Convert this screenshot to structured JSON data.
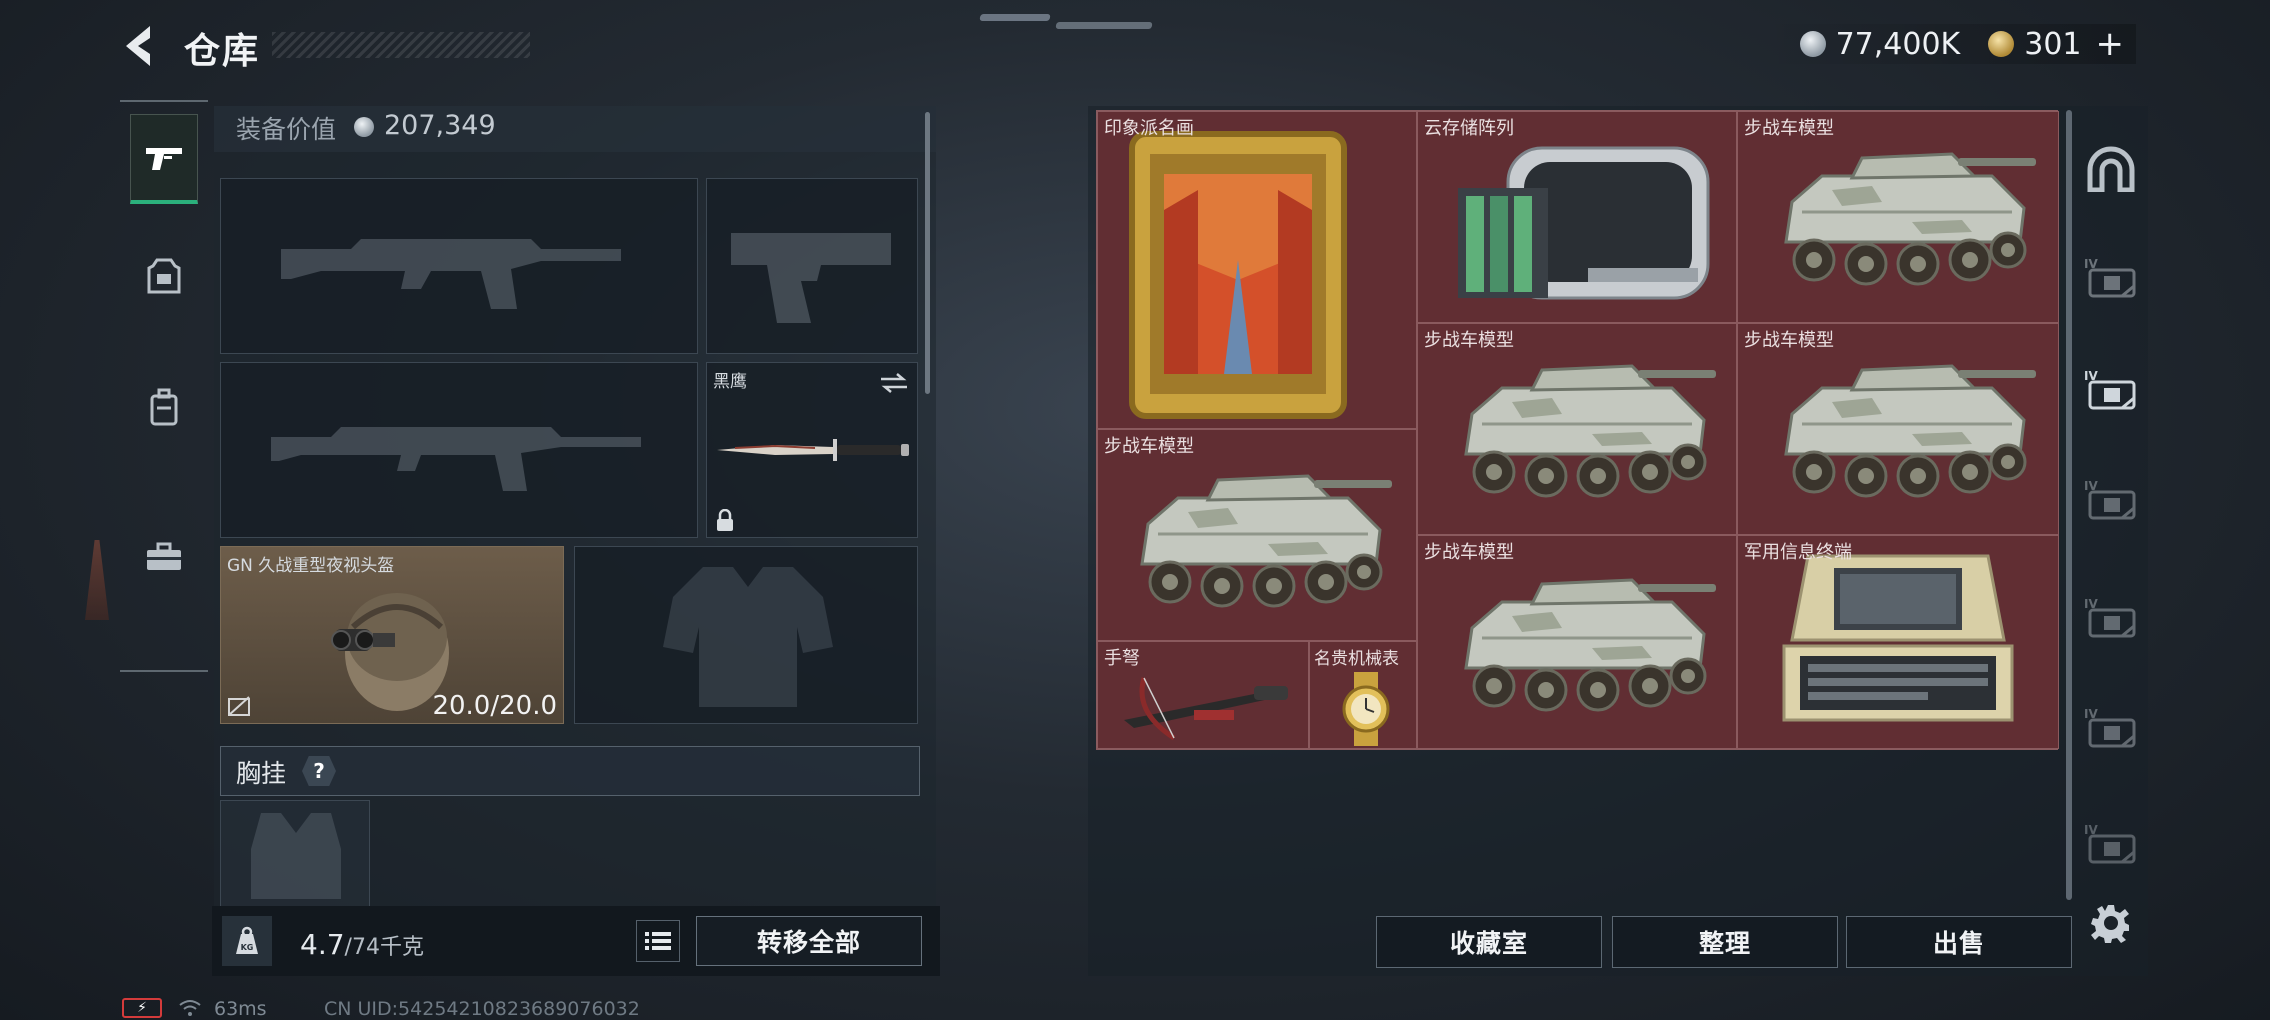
{
  "header": {
    "title": "仓库",
    "currency_silver": "77,400K",
    "currency_gold": "301",
    "add_label": "+"
  },
  "equipment": {
    "value_label": "装备价值",
    "value": "207,349",
    "melee_name": "黑鹰",
    "helmet_name": "GN 久战重型夜视头盔",
    "helmet_durability": "20.0/20.0",
    "chest_rig_label": "胸挂",
    "help_mark": "?"
  },
  "footer_left": {
    "weight_current": "4.7",
    "weight_max": "/74千克",
    "transfer_all": "转移全部"
  },
  "stash": {
    "items": [
      {
        "name": "印象派名画"
      },
      {
        "name": "云存储阵列"
      },
      {
        "name": "步战车模型"
      },
      {
        "name": "步战车模型"
      },
      {
        "name": "步战车模型"
      },
      {
        "name": "步战车模型"
      },
      {
        "name": "步战车模型"
      },
      {
        "name": "军用信息终端"
      },
      {
        "name": "手弩"
      },
      {
        "name": "名贵机械表"
      }
    ]
  },
  "actions": {
    "collection": "收藏室",
    "sort": "整理",
    "sell": "出售"
  },
  "status": {
    "ping": "63ms",
    "uid": "CN UID:54254210823689076032"
  },
  "colors": {
    "accent_green": "#2bb07c",
    "grid_bg": "#612e33",
    "panel_bg": "#1e262e"
  },
  "icons": [
    "back-arrow-icon",
    "pistol-icon",
    "armor-icon",
    "backpack-icon",
    "toolbox-icon",
    "kg-weight-icon",
    "list-icon",
    "arch-icon",
    "case-icon",
    "gear-icon",
    "wifi-icon",
    "battery-icon"
  ]
}
